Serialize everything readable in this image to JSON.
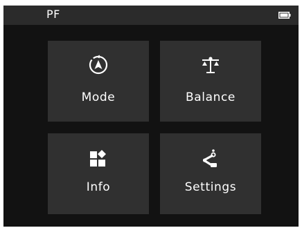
{
  "status_bar": {
    "title": "PF",
    "battery_icon": "battery-icon"
  },
  "menu": {
    "items": [
      {
        "label": "Mode",
        "icon": "mode-compass-icon"
      },
      {
        "label": "Balance",
        "icon": "balance-scale-icon"
      },
      {
        "label": "Info",
        "icon": "info-grid-icon"
      },
      {
        "label": "Settings",
        "icon": "settings-arm-icon"
      }
    ]
  },
  "colors": {
    "screen_bg": "#121212",
    "status_bar_bg": "#2b2b2b",
    "tile_bg": "#303030",
    "text": "#ffffff"
  }
}
